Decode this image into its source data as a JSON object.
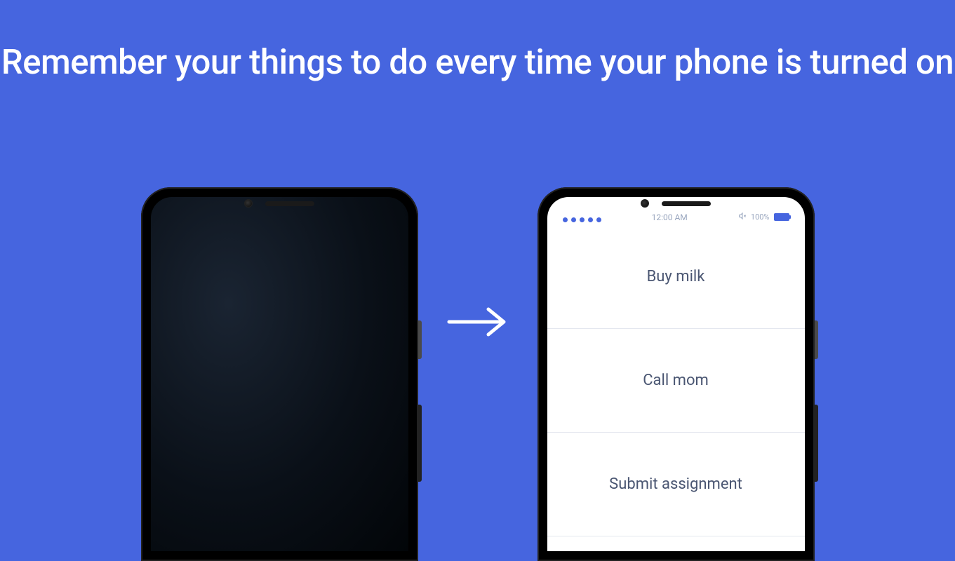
{
  "headline": "Remember your things to do every time your phone is turned on",
  "phone_on": {
    "status_time": "12:00 AM",
    "status_battery_pct": "100%",
    "todos": [
      "Buy milk",
      "Call mom",
      "Submit assignment"
    ]
  }
}
